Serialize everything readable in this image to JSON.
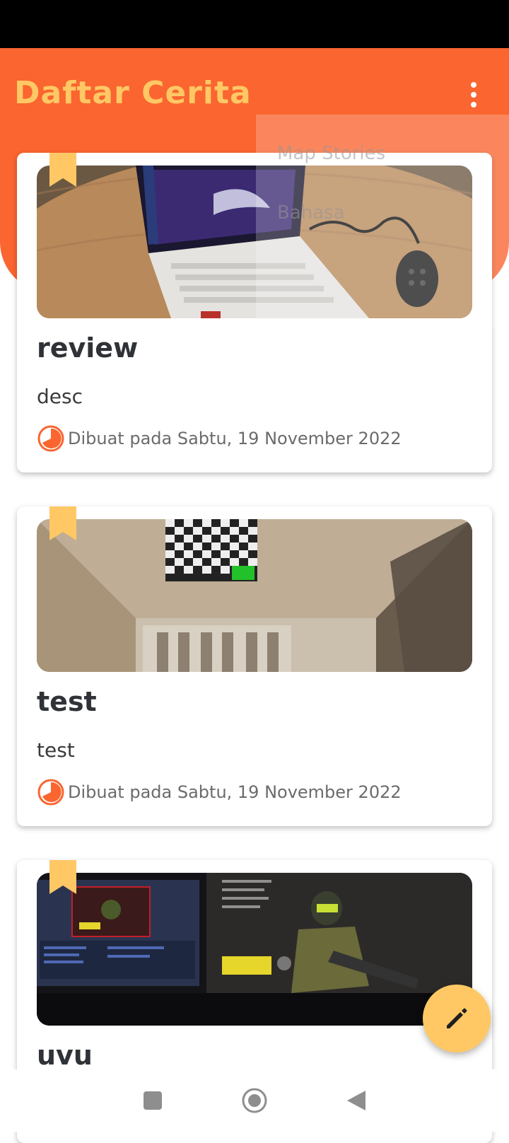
{
  "app": {
    "title": "Daftar Cerita",
    "colors": {
      "header": "#fa6530",
      "title": "#ffc865",
      "accent": "#ffc865"
    }
  },
  "menu": {
    "items": [
      {
        "label": "Map Stories"
      },
      {
        "label": "Bahasa"
      }
    ]
  },
  "stories": [
    {
      "title": "review",
      "description": "desc",
      "date": "Dibuat pada Sabtu, 19 November 2022",
      "image": "laptop-on-desk"
    },
    {
      "title": "test",
      "description": "test",
      "date": "Dibuat pada Sabtu, 19 November 2022",
      "image": "room-ceiling"
    },
    {
      "title": "uvu",
      "description": "",
      "date": "",
      "image": "gaming-monitors"
    }
  ],
  "icons": {
    "bookmark": "bookmark-icon",
    "clock": "clock-icon",
    "fab": "pencil-icon",
    "overflow": "more-vert-icon"
  },
  "navbar": [
    "recents-icon",
    "home-icon",
    "back-icon"
  ]
}
